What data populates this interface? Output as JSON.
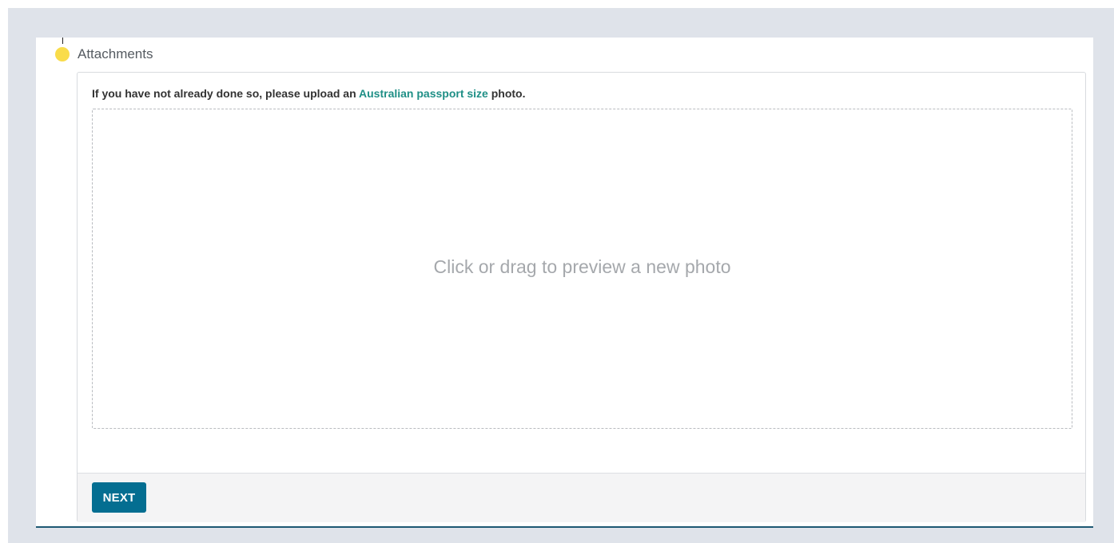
{
  "section": {
    "title": "Attachments",
    "status_color": "#f9dc4a"
  },
  "instruction": {
    "prefix": "If you have not already done so, please upload an",
    "link_text": "Australian passport size",
    "suffix": "photo."
  },
  "dropzone": {
    "placeholder": "Click or drag to preview a new photo"
  },
  "footer": {
    "next_label": "NEXT"
  },
  "colors": {
    "page_background": "#dfe3ea",
    "link": "#1f8f86",
    "primary_button": "#046e91",
    "card_bottom_border": "#1d5873"
  }
}
